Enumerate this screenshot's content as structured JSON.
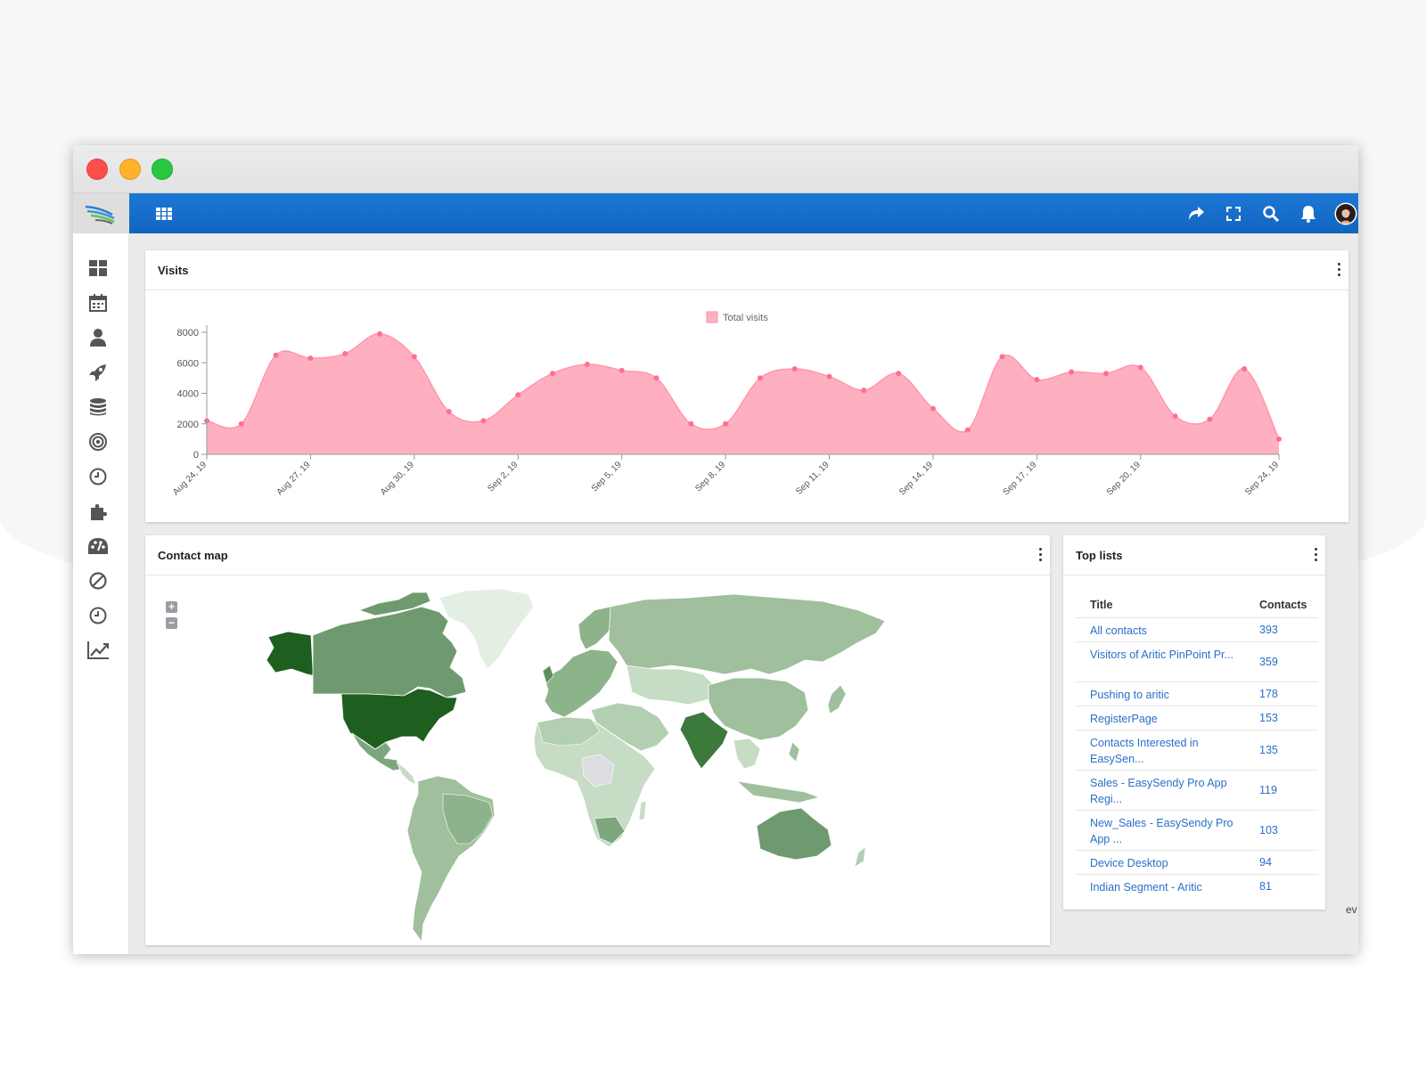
{
  "header": {
    "icons": [
      "grid-icon",
      "share-icon",
      "fullscreen-icon",
      "search-icon",
      "bell-icon",
      "avatar",
      "gear-icon",
      "hamburger-icon"
    ]
  },
  "sidebar": {
    "icons": [
      "dashboard-icon",
      "calendar-icon",
      "user-icon",
      "rocket-icon",
      "database-icon",
      "target-icon",
      "clock-icon",
      "puzzle-icon",
      "palette-icon",
      "block-icon",
      "history-icon",
      "chart-line-icon"
    ]
  },
  "visits": {
    "title": "Visits",
    "legend_label": "Total visits"
  },
  "chart_data": {
    "type": "area",
    "series": [
      {
        "name": "Total visits",
        "color": "#ffb0c0",
        "values": [
          2200,
          2000,
          6500,
          6300,
          6600,
          7900,
          6400,
          2800,
          2200,
          3900,
          5300,
          5900,
          5500,
          5000,
          2000,
          2000,
          5000,
          5600,
          5100,
          4200,
          5300,
          3000,
          1600,
          6400,
          4900,
          5400,
          5300,
          5700,
          2500,
          2300,
          5600,
          1000
        ]
      }
    ],
    "x_tick_labels": [
      "Aug 24, 19",
      "Aug 27, 19",
      "Aug 30, 19",
      "Sep 2, 19",
      "Sep 5, 19",
      "Sep 8, 19",
      "Sep 11, 19",
      "Sep 14, 19",
      "Sep 17, 19",
      "Sep 20, 19",
      "Sep 24, 19"
    ],
    "x_tick_indices": [
      0,
      3,
      6,
      9,
      12,
      15,
      18,
      21,
      24,
      27,
      31
    ],
    "y_ticks": [
      0,
      2000,
      4000,
      6000,
      8000
    ],
    "ylim": [
      0,
      8000
    ],
    "legend": "top-center",
    "grid": false
  },
  "contact_map": {
    "title": "Contact map",
    "zoom_in": "+",
    "zoom_out": "−"
  },
  "top_lists": {
    "title": "Top lists",
    "col_title": "Title",
    "col_contacts": "Contacts",
    "rows": [
      {
        "title": "All contacts",
        "contacts": "393"
      },
      {
        "title": "Visitors of Aritic PinPoint Pr...",
        "contacts": "359"
      },
      {
        "title": "Pushing to aritic",
        "contacts": "178"
      },
      {
        "title": "RegisterPage",
        "contacts": "153"
      },
      {
        "title": "Contacts Interested in EasySen...",
        "contacts": "135"
      },
      {
        "title": "Sales - EasySendy Pro App Regi...",
        "contacts": "119"
      },
      {
        "title": "New_Sales - EasySendy Pro App ...",
        "contacts": "103"
      },
      {
        "title": "Device Desktop",
        "contacts": "94"
      },
      {
        "title": "Indian Segment - Aritic",
        "contacts": "81"
      }
    ]
  },
  "footer_fragment": "ev"
}
